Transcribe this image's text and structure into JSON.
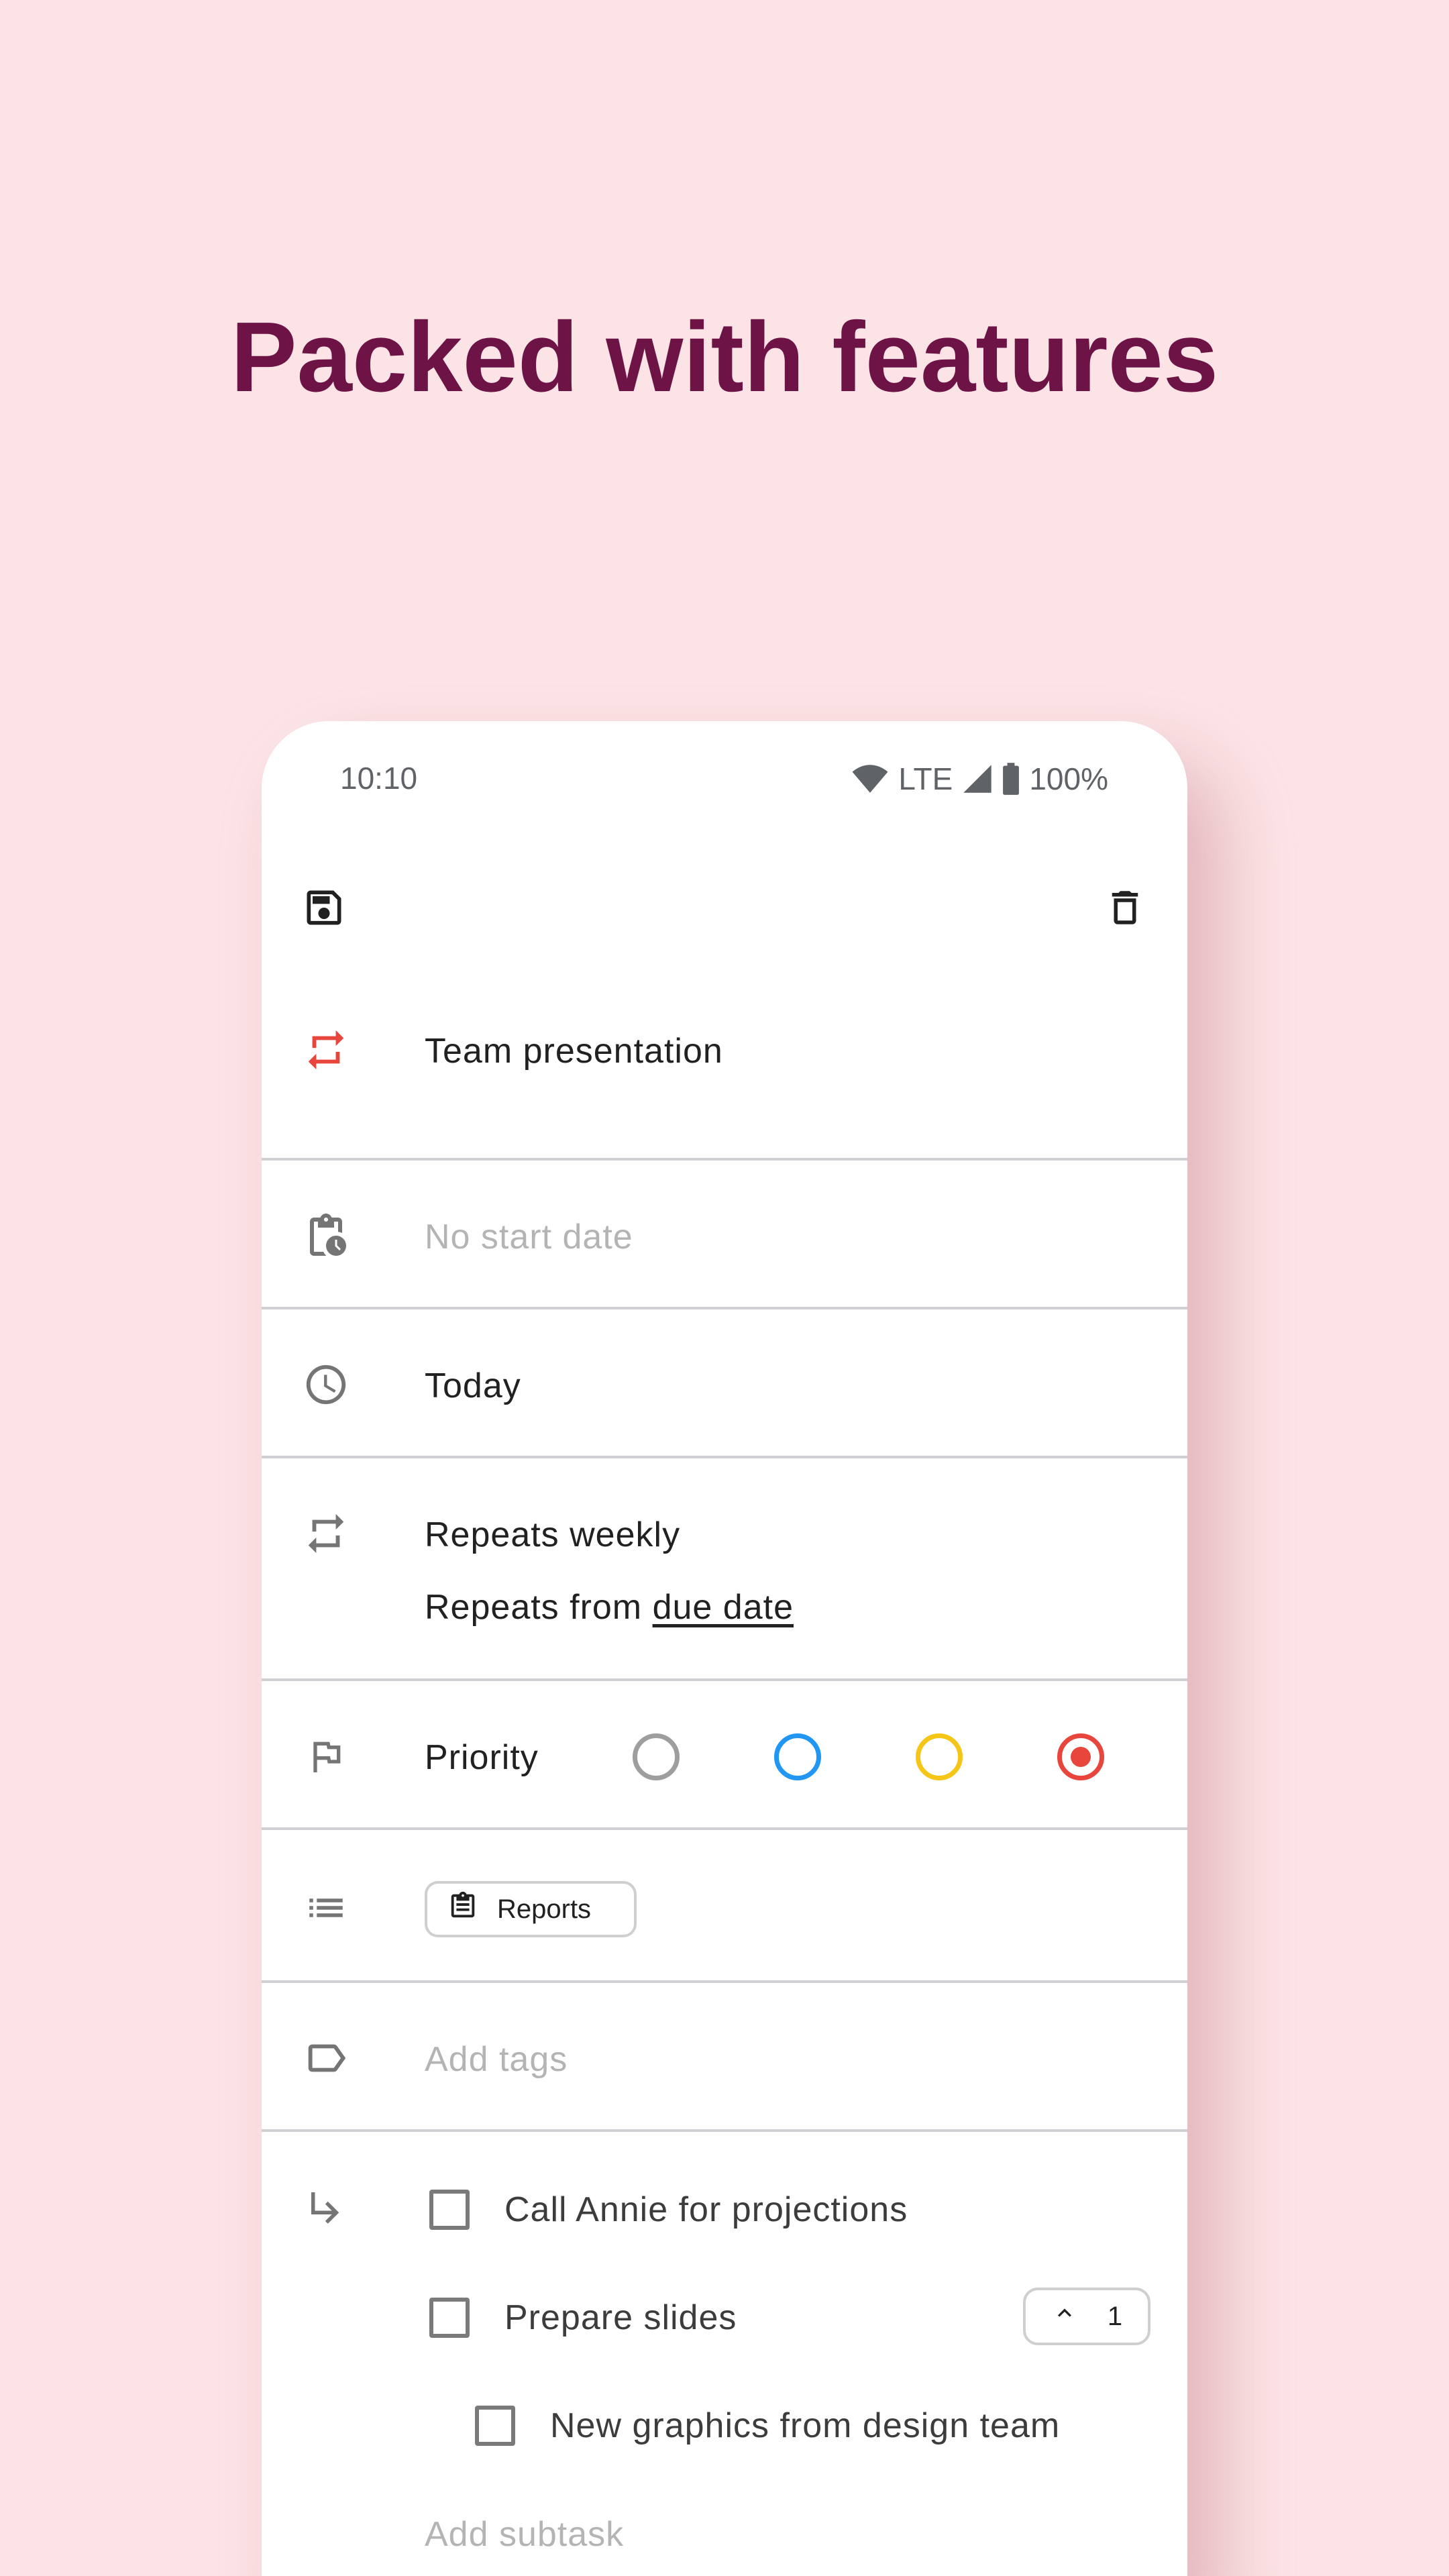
{
  "headline": "Packed with features",
  "status": {
    "time": "10:10",
    "network": "LTE",
    "battery": "100%"
  },
  "toolbar": {
    "save_icon": "save-icon",
    "delete_icon": "delete-icon"
  },
  "task": {
    "title": "Team presentation",
    "start_date_placeholder": "No start date",
    "due_date": "Today",
    "repeat": {
      "summary": "Repeats weekly",
      "from_prefix": "Repeats from",
      "from_value": "due date"
    },
    "priority": {
      "label": "Priority",
      "options": [
        {
          "color": "#9e9e9e",
          "selected": false
        },
        {
          "color": "#2196f3",
          "selected": false
        },
        {
          "color": "#f5c518",
          "selected": false
        },
        {
          "color": "#e8453c",
          "selected": true
        }
      ]
    },
    "list_chip": "Reports",
    "tags_placeholder": "Add tags",
    "subtasks": [
      {
        "label": "Call Annie for projections",
        "checked": false,
        "indent": 0
      },
      {
        "label": "Prepare slides",
        "checked": false,
        "indent": 0,
        "collapse_count": "1"
      },
      {
        "label": "New graphics from design team",
        "checked": false,
        "indent": 1
      }
    ],
    "add_subtask_placeholder": "Add subtask"
  },
  "colors": {
    "background": "#fce4e6",
    "headline": "#6d1346",
    "accent_red": "#e8453c"
  }
}
